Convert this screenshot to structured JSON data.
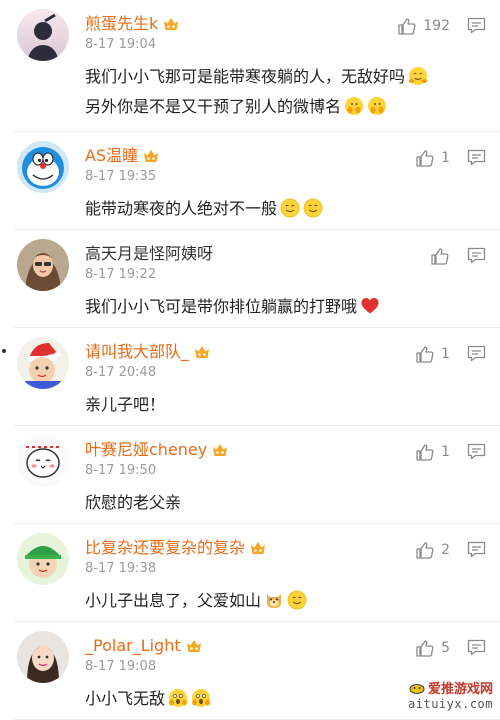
{
  "comments": [
    {
      "name": "煎蛋先生k",
      "verified": true,
      "time": "8-17 19:04",
      "likes": "192",
      "avatar": "avatar-silhouette",
      "lines": [
        {
          "text": "我们小小飞那可是能带寒夜躺的人，无敌好吗",
          "emojis": [
            "hug-emoji"
          ]
        },
        {
          "text": "另外你是不是又干预了别人的微博名",
          "emojis": [
            "peek-emoji",
            "peek-emoji"
          ]
        }
      ]
    },
    {
      "name": "AS温瞳",
      "verified": true,
      "time": "8-17 19:35",
      "likes": "1",
      "avatar": "avatar-robot-cat",
      "lines": [
        {
          "text": "能带动寒夜的人绝对不一般",
          "emojis": [
            "smile-emoji",
            "smile-emoji"
          ]
        }
      ]
    },
    {
      "name": "高天月是怪阿姨呀",
      "verified": false,
      "time": "8-17 19:22",
      "likes": "",
      "avatar": "avatar-girl",
      "lines": [
        {
          "text": "我们小小飞可是带你排位躺赢的打野哦",
          "emojis": [
            "heart-emoji"
          ]
        }
      ]
    },
    {
      "name": "请叫我大部队_",
      "verified": true,
      "time": "8-17 20:48",
      "likes": "1",
      "avatar": "avatar-child-santa",
      "lines": [
        {
          "text": "亲儿子吧！",
          "emojis": []
        }
      ]
    },
    {
      "name": "叶赛尼娅cheney",
      "verified": true,
      "time": "8-17 19:50",
      "likes": "1",
      "avatar": "avatar-cartoon",
      "lines": [
        {
          "text": "欣慰的老父亲",
          "emojis": []
        }
      ]
    },
    {
      "name": "比复杂还要复杂的复杂",
      "verified": true,
      "time": "8-17 19:38",
      "likes": "2",
      "avatar": "avatar-green-hat",
      "lines": [
        {
          "text": "小儿子出息了，父爱如山",
          "emojis": [
            "doge-emoji",
            "smile-emoji"
          ]
        }
      ]
    },
    {
      "name": "_Polar_Light",
      "verified": true,
      "time": "8-17 19:08",
      "likes": "5",
      "avatar": "avatar-woman",
      "lines": [
        {
          "text": "小小飞无敌",
          "emojis": [
            "shock-emoji",
            "shock-emoji"
          ]
        }
      ]
    }
  ],
  "watermark": {
    "title": "爱推游戏网",
    "url": "aituiyx.com"
  },
  "colors": {
    "name": "#e86b17",
    "time": "#9b9b9b",
    "text": "#222222",
    "divider": "#ececec",
    "vip": "#f5a623"
  }
}
